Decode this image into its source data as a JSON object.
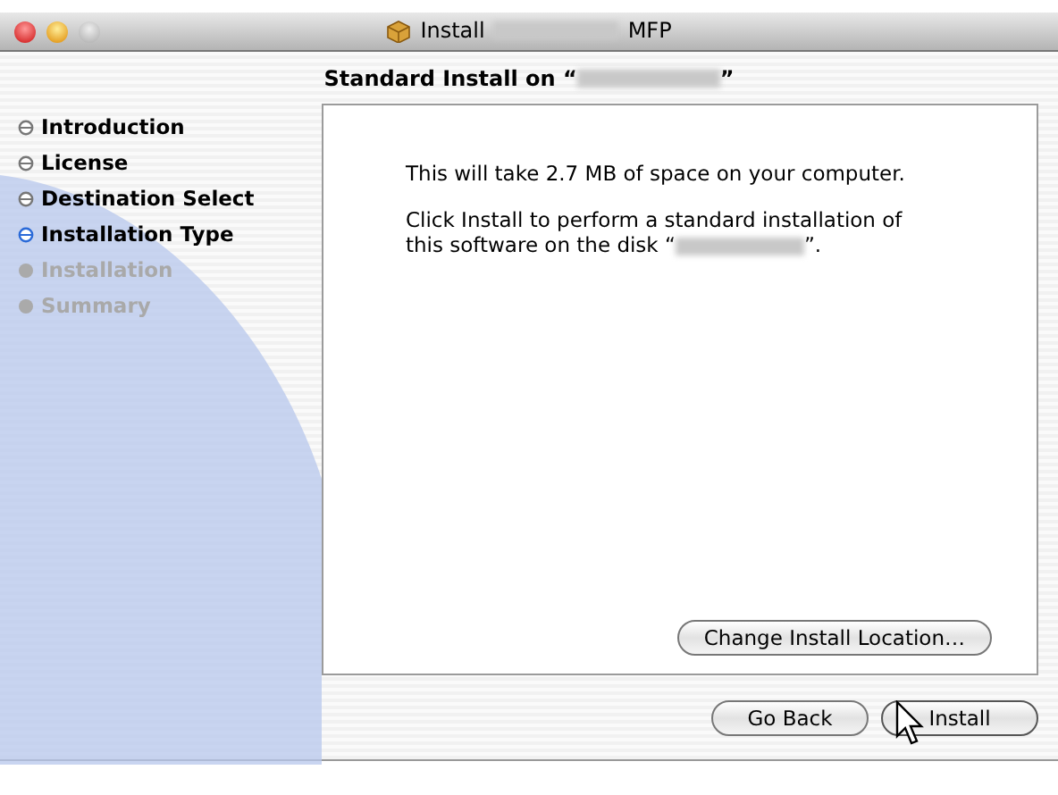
{
  "window": {
    "title_prefix": "Install",
    "title_suffix": "MFP"
  },
  "heading": {
    "prefix": "Standard Install on “",
    "suffix": "”"
  },
  "steps": [
    {
      "label": "Introduction",
      "selected": false,
      "disabled": false
    },
    {
      "label": "License",
      "selected": false,
      "disabled": false
    },
    {
      "label": "Destination Select",
      "selected": false,
      "disabled": false
    },
    {
      "label": "Installation Type",
      "selected": true,
      "disabled": false
    },
    {
      "label": "Installation",
      "selected": false,
      "disabled": true
    },
    {
      "label": "Summary",
      "selected": false,
      "disabled": true
    }
  ],
  "message": {
    "line": "This will take 2.7 MB of space on your computer.",
    "detail_prefix": "Click Install to perform a standard installation of this software on the disk “",
    "detail_suffix": "”."
  },
  "change_location_button": "Change Install Location…",
  "buttons": [
    {
      "label": "Go Back",
      "kind": "back"
    },
    {
      "label": "Install",
      "kind": "default"
    }
  ]
}
